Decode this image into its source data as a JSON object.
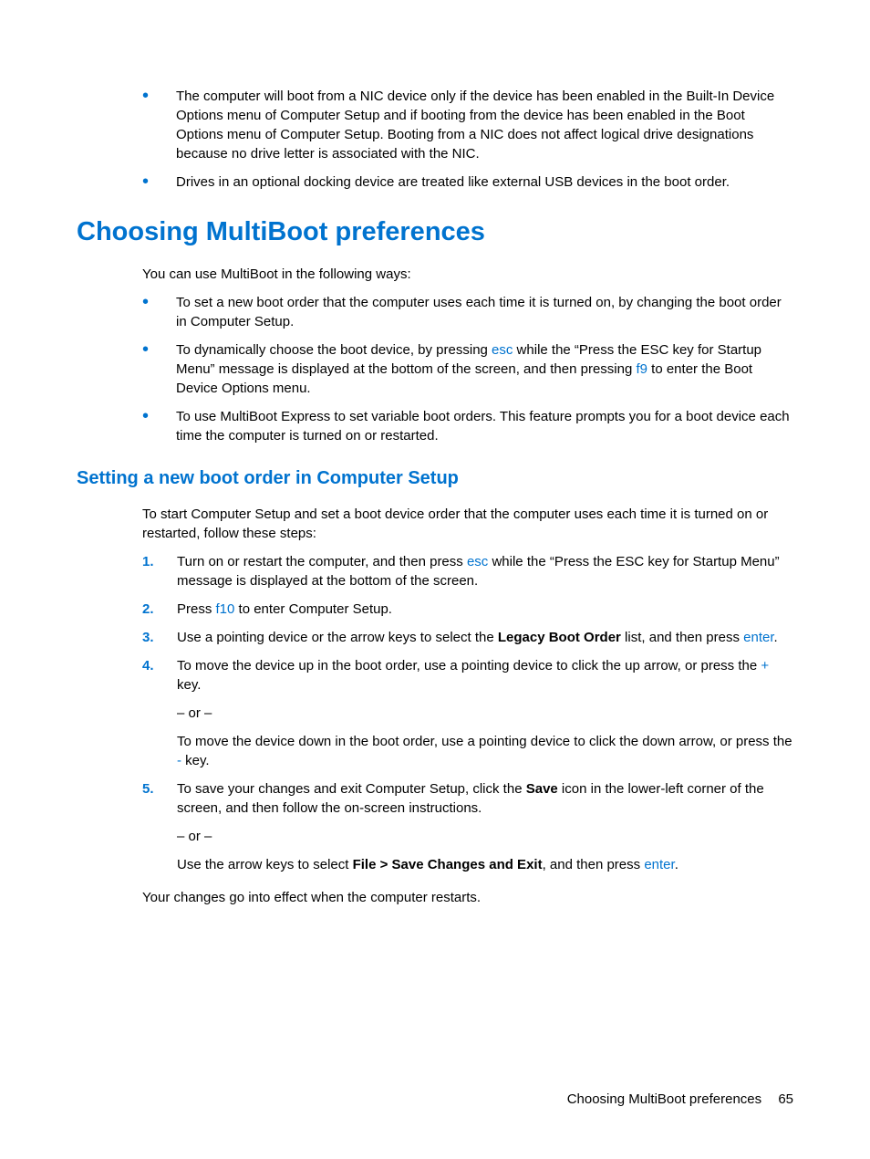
{
  "topBullets": {
    "item1": "The computer will boot from a NIC device only if the device has been enabled in the Built-In Device Options menu of Computer Setup and if booting from the device has been enabled in the Boot Options menu of Computer Setup. Booting from a NIC does not affect logical drive designations because no drive letter is associated with the NIC.",
    "item2": "Drives in an optional docking device are treated like external USB devices in the boot order."
  },
  "h1": "Choosing MultiBoot preferences",
  "intro": "You can use MultiBoot in the following ways:",
  "waysBullets": {
    "item1": "To set a new boot order that the computer uses each time it is turned on, by changing the boot order in Computer Setup.",
    "item2_a": "To dynamically choose the boot device, by pressing ",
    "item2_esc": "esc",
    "item2_b": " while the “Press the ESC key for Startup Menu” message is displayed at the bottom of the screen, and then pressing ",
    "item2_f9": "f9",
    "item2_c": " to enter the Boot Device Options menu.",
    "item3": "To use MultiBoot Express to set variable boot orders. This feature prompts you for a boot device each time the computer is turned on or restarted."
  },
  "h2": "Setting a new boot order in Computer Setup",
  "stepsIntro": "To start Computer Setup and set a boot device order that the computer uses each time it is turned on or restarted, follow these steps:",
  "steps": {
    "n1": "1.",
    "s1_a": "Turn on or restart the computer, and then press ",
    "s1_esc": "esc",
    "s1_b": " while the “Press the ESC key for Startup Menu” message is displayed at the bottom of the screen.",
    "n2": "2.",
    "s2_a": "Press ",
    "s2_f10": "f10",
    "s2_b": " to enter Computer Setup.",
    "n3": "3.",
    "s3_a": "Use a pointing device or the arrow keys to select the ",
    "s3_bold": "Legacy Boot Order",
    "s3_b": " list, and then press ",
    "s3_enter": "enter",
    "s3_c": ".",
    "n4": "4.",
    "s4_p1_a": "To move the device up in the boot order, use a pointing device to click the up arrow, or press the ",
    "s4_p1_plus": "+",
    "s4_p1_b": " key.",
    "s4_or": "– or –",
    "s4_p2_a": "To move the device down in the boot order, use a pointing device to click the down arrow, or press the ",
    "s4_p2_minus": "-",
    "s4_p2_b": " key.",
    "n5": "5.",
    "s5_p1_a": "To save your changes and exit Computer Setup, click the ",
    "s5_p1_save": "Save",
    "s5_p1_b": " icon in the lower-left corner of the screen, and then follow the on-screen instructions.",
    "s5_or": "– or –",
    "s5_p2_a": "Use the arrow keys to select ",
    "s5_p2_bold": "File > Save Changes and Exit",
    "s5_p2_b": ", and then press ",
    "s5_p2_enter": "enter",
    "s5_p2_c": "."
  },
  "closing": "Your changes go into effect when the computer restarts.",
  "footer": {
    "text": "Choosing MultiBoot preferences",
    "page": "65"
  }
}
